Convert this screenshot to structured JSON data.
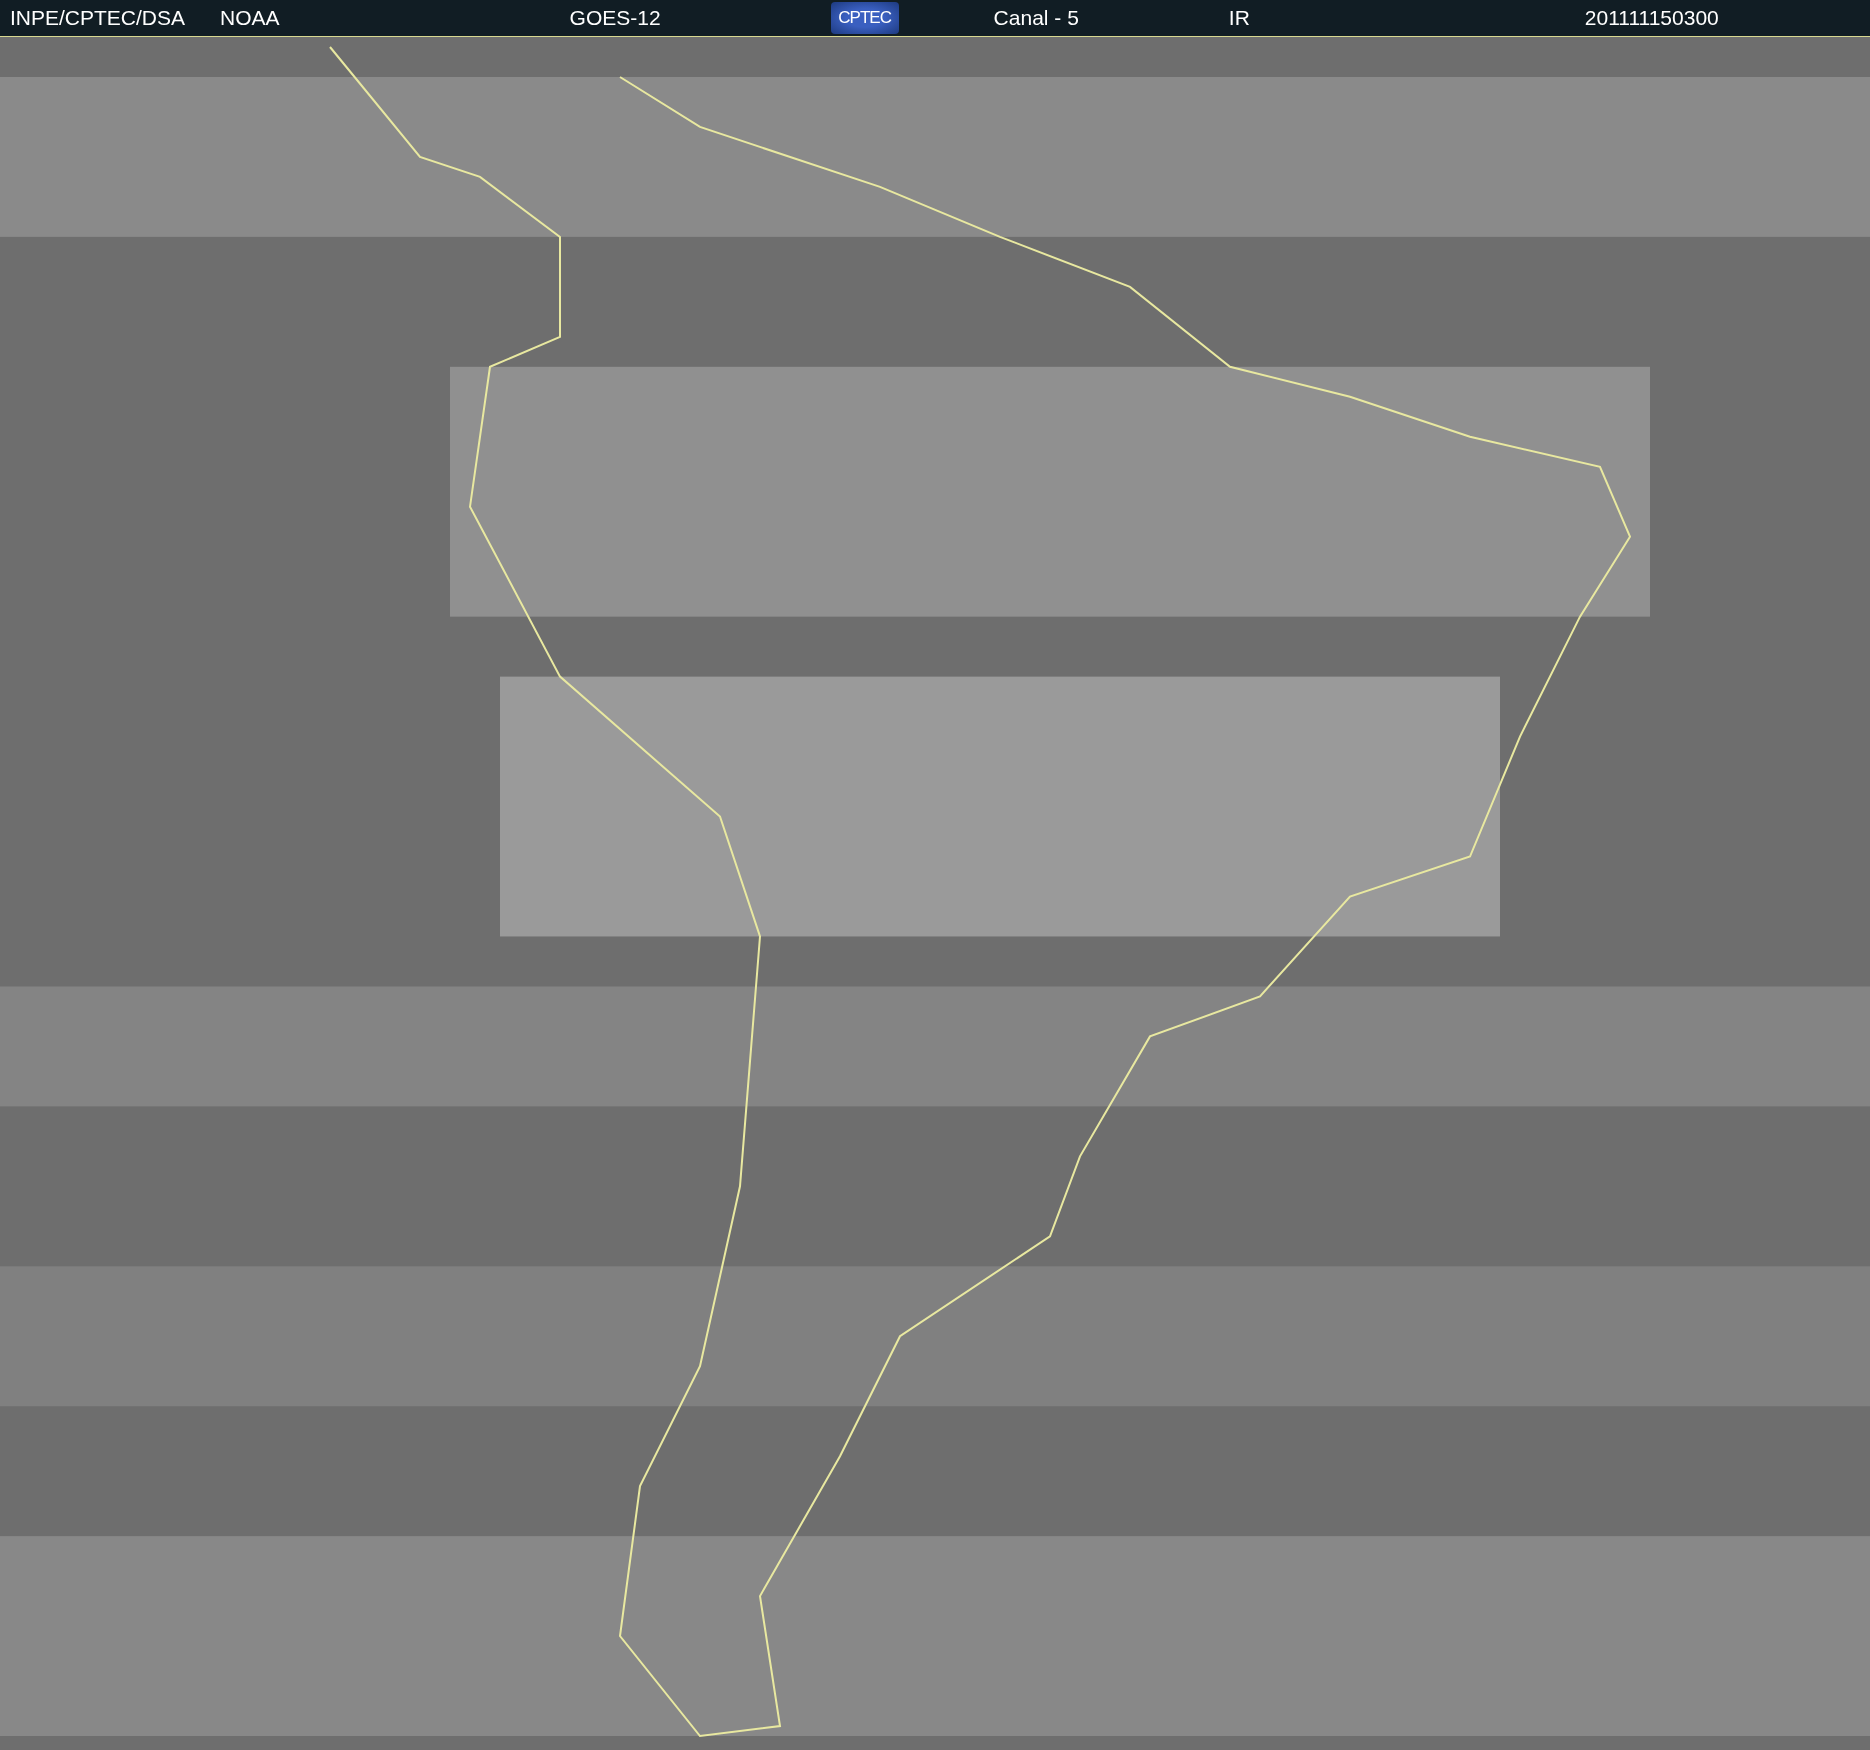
{
  "header": {
    "source": "INPE/CPTEC/DSA",
    "agency": "NOAA",
    "satellite": "GOES-12",
    "logo": "CPTEC",
    "channel": "Canal - 5",
    "band": "IR",
    "timestamp": "201111150300"
  }
}
